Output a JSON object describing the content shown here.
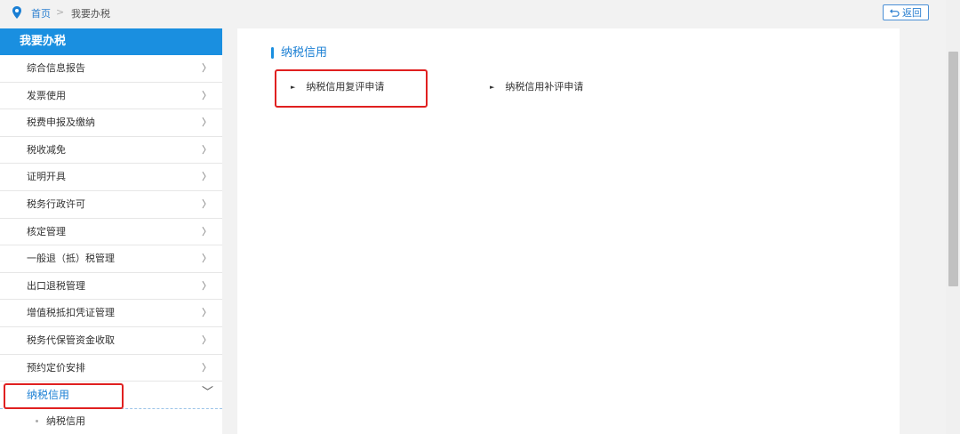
{
  "breadcrumb": {
    "home": "首页",
    "separator": ">",
    "current": "我要办税"
  },
  "back_button": {
    "label": "返回"
  },
  "sidebar": {
    "title": "我要办税",
    "items": [
      {
        "label": "综合信息报告",
        "chevron": "〉"
      },
      {
        "label": "发票使用",
        "chevron": "〉"
      },
      {
        "label": "税费申报及缴纳",
        "chevron": "〉"
      },
      {
        "label": "税收减免",
        "chevron": "〉"
      },
      {
        "label": "证明开具",
        "chevron": "〉"
      },
      {
        "label": "税务行政许可",
        "chevron": "〉"
      },
      {
        "label": "核定管理",
        "chevron": "〉"
      },
      {
        "label": "一般退（抵）税管理",
        "chevron": "〉"
      },
      {
        "label": "出口退税管理",
        "chevron": "〉"
      },
      {
        "label": "增值税抵扣凭证管理",
        "chevron": "〉"
      },
      {
        "label": "税务代保管资金收取",
        "chevron": "〉"
      },
      {
        "label": "预约定价安排",
        "chevron": "〉"
      }
    ],
    "active_item": {
      "label": "纳税信用",
      "chevron": "﹀"
    },
    "sub_items": [
      {
        "label": "纳税信用"
      }
    ]
  },
  "main": {
    "section_title": "纳税信用",
    "options": [
      {
        "label": "纳税信用复评申请",
        "arrow": "►"
      },
      {
        "label": "纳税信用补评申请",
        "arrow": "►"
      }
    ]
  },
  "colors": {
    "accent": "#1a8fe0",
    "highlight": "#e02020",
    "link": "#2a7fd0"
  }
}
